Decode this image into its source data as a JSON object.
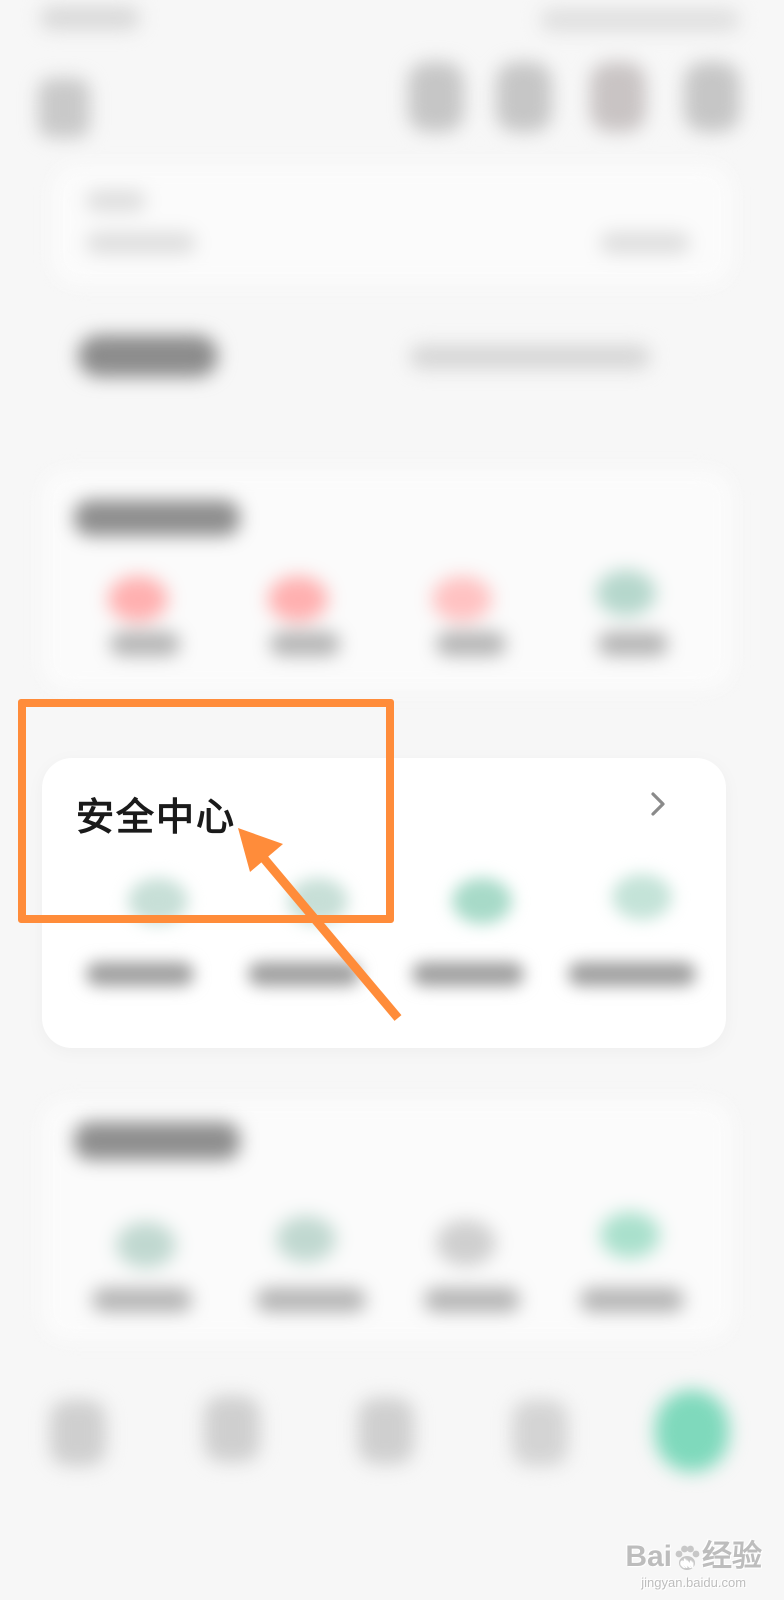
{
  "security_center": {
    "title": "安全中心"
  },
  "watermark": {
    "brand_prefix": "Bai",
    "brand_suffix": "经验",
    "url": "jingyan.baidu.com"
  },
  "colors": {
    "annotation": "#ff8c3a",
    "accent_green": "#7fd9bc",
    "accent_red": "#ff9c9c"
  },
  "icons": {
    "chevron": "chevron-right-icon",
    "paw": "baidu-paw-icon"
  }
}
